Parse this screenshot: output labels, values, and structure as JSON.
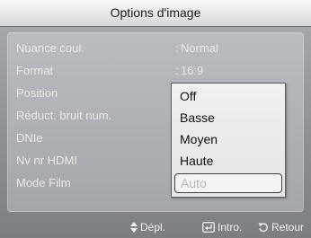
{
  "window": {
    "title": "Options d'image"
  },
  "menu": {
    "items": [
      {
        "label": "Nuance coul.",
        "value": "Normal"
      },
      {
        "label": "Format",
        "value": "16:9"
      },
      {
        "label": "Position",
        "value": ""
      },
      {
        "label": "Réduct. bruit num.",
        "value": ""
      },
      {
        "label": "DNIe",
        "value": ""
      },
      {
        "label": "Nv nr HDMI",
        "value": ""
      },
      {
        "label": "Mode Film",
        "value": ""
      }
    ]
  },
  "dropdown": {
    "options": [
      "Off",
      "Basse",
      "Moyen",
      "Haute",
      "Auto"
    ],
    "selected": "Auto"
  },
  "footer": {
    "move_label": "Dépl.",
    "enter_label": "Intro.",
    "return_label": "Retour",
    "icons": [
      "updown-arrow-icon",
      "enter-icon",
      "return-icon"
    ]
  },
  "colors": {
    "title_bar": "#e6e6e6",
    "background": "#8e9196",
    "menu_text": "#e9e9e9",
    "dropdown_bg": "#f0f0f0",
    "disabled_text": "#b8b8b8"
  }
}
